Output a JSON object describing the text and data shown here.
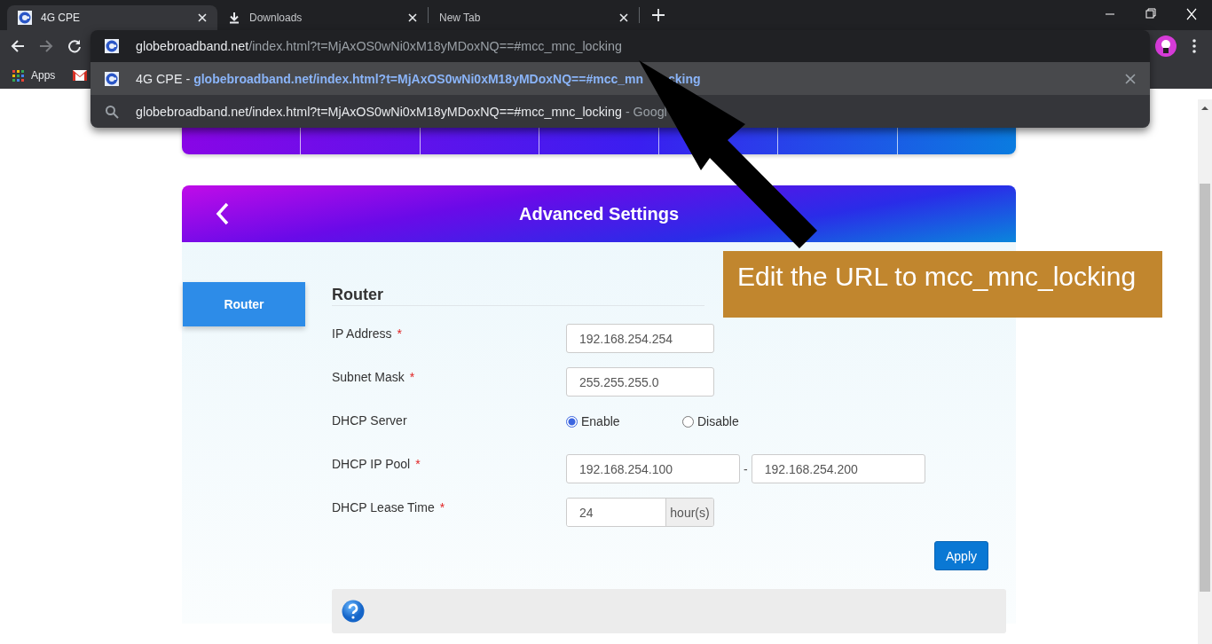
{
  "browser": {
    "tabs": [
      {
        "kind": "site",
        "title": "4G CPE",
        "selected": true
      },
      {
        "kind": "download",
        "title": "Downloads",
        "selected": false
      },
      {
        "kind": "blank",
        "title": "New Tab",
        "selected": false
      }
    ],
    "bookmarks": [
      {
        "kind": "apps",
        "label": "Apps"
      },
      {
        "kind": "mail"
      }
    ],
    "omnibox": {
      "host": "globebroadband.net",
      "path": "/index.html?t=MjAxOS0wNi0xM18yMDoxNQ==#mcc_mnc_locking",
      "suggestions": [
        {
          "kind": "page",
          "text": "4G CPE -",
          "detail": "globebroadband.net/index.html?t=MjAxOS0wNi0xM18yMDoxNQ==#mcc_mn",
          "detail_tail": "cking",
          "selected": true
        },
        {
          "kind": "search",
          "text": "globebroadband.net/index.html?t=MjAxOS0wNi0xM18yMDoxNQ==#mcc_mnc_locking",
          "detail": "- Googl",
          "selected": false
        }
      ]
    }
  },
  "panel": {
    "title": "Advanced Settings",
    "side_tabs": [
      {
        "label": "Router",
        "selected": true
      }
    ],
    "section": "Router",
    "required_mark": "*",
    "fields": [
      {
        "kind": "text",
        "label": "IP Address",
        "required": true,
        "value": "192.168.254.254"
      },
      {
        "kind": "text",
        "label": "Subnet Mask",
        "required": true,
        "value": "255.255.255.0"
      },
      {
        "kind": "radio",
        "label": "DHCP Server",
        "required": false,
        "options": [
          {
            "label": "Enable",
            "selected": true
          },
          {
            "label": "Disable",
            "selected": false
          }
        ]
      },
      {
        "kind": "range",
        "label": "DHCP IP Pool",
        "required": true,
        "values": [
          "192.168.254.100",
          "192.168.254.200"
        ],
        "separator": "-"
      },
      {
        "kind": "unit",
        "label": "DHCP Lease Time",
        "required": true,
        "value": "24",
        "unit": "hour(s)"
      }
    ],
    "apply": "Apply"
  },
  "annotation": {
    "text": "Edit the URL to mcc_mnc_locking"
  }
}
